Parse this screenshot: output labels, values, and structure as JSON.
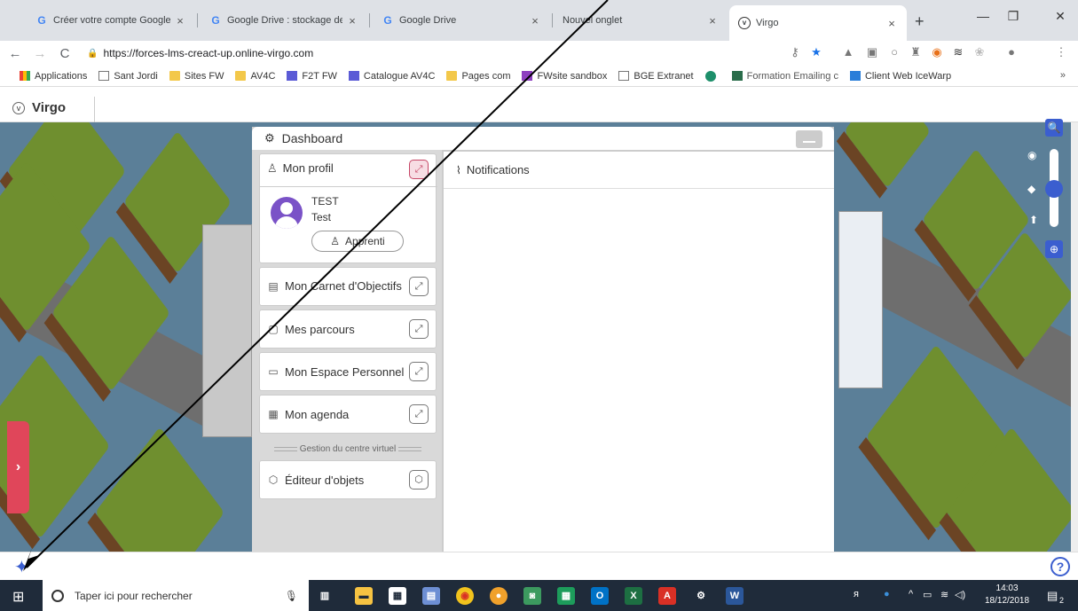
{
  "browser": {
    "tabs": [
      {
        "title": "Créer votre compte Google",
        "icon": "google-icon"
      },
      {
        "title": "Google Drive : stockage de fich",
        "icon": "google-icon"
      },
      {
        "title": "Google Drive",
        "icon": "google-icon"
      },
      {
        "title": "Nouvel onglet",
        "icon": ""
      },
      {
        "title": "Virgo",
        "icon": "virgo-icon",
        "active": true
      }
    ],
    "url": "https://forces-lms-creact-up.online-virgo.com",
    "bookmarks": [
      {
        "label": "Applications",
        "icon": "apps-grid-icon"
      },
      {
        "label": "Sant Jordi",
        "icon": "page-icon"
      },
      {
        "label": "Sites FW",
        "icon": "folder-icon"
      },
      {
        "label": "AV4C",
        "icon": "folder-icon"
      },
      {
        "label": "F2T FW",
        "icon": "list-icon"
      },
      {
        "label": "Catalogue AV4C",
        "icon": "list-icon"
      },
      {
        "label": "Pages com",
        "icon": "folder-icon"
      },
      {
        "label": "FWsite sandbox",
        "icon": "fw-icon"
      },
      {
        "label": "BGE Extranet",
        "icon": "page-icon"
      },
      {
        "label": "",
        "icon": "circle-icon"
      },
      {
        "label": "Formation Emailing c",
        "icon": "gmail-icon"
      },
      {
        "label": "Client Web IceWarp",
        "icon": "mail-icon"
      }
    ],
    "more": "»"
  },
  "app": {
    "name": "Virgo"
  },
  "dashboard": {
    "title": "Dashboard",
    "profile": {
      "header": "Mon profil",
      "name": "TEST",
      "subname": "Test",
      "role": "Apprenti"
    },
    "menu": [
      {
        "label": "Mon Carnet d'Objectifs",
        "icon": "notebook-icon"
      },
      {
        "label": "Mes parcours",
        "icon": "path-icon"
      },
      {
        "label": "Mon Espace Personnel",
        "icon": "briefcase-icon"
      },
      {
        "label": "Mon agenda",
        "icon": "calendar-icon"
      }
    ],
    "section": "Gestion du centre virtuel",
    "editor": "Éditeur d'objets",
    "notifications": "Notifications"
  },
  "taskbar": {
    "search_placeholder": "Taper ici pour rechercher",
    "time": "14:03",
    "date": "18/12/2018",
    "notification_count": "2"
  },
  "colors": {
    "accent": "#3b5ecf",
    "side_tab": "#e0465a",
    "profile_button": "#c64666"
  }
}
